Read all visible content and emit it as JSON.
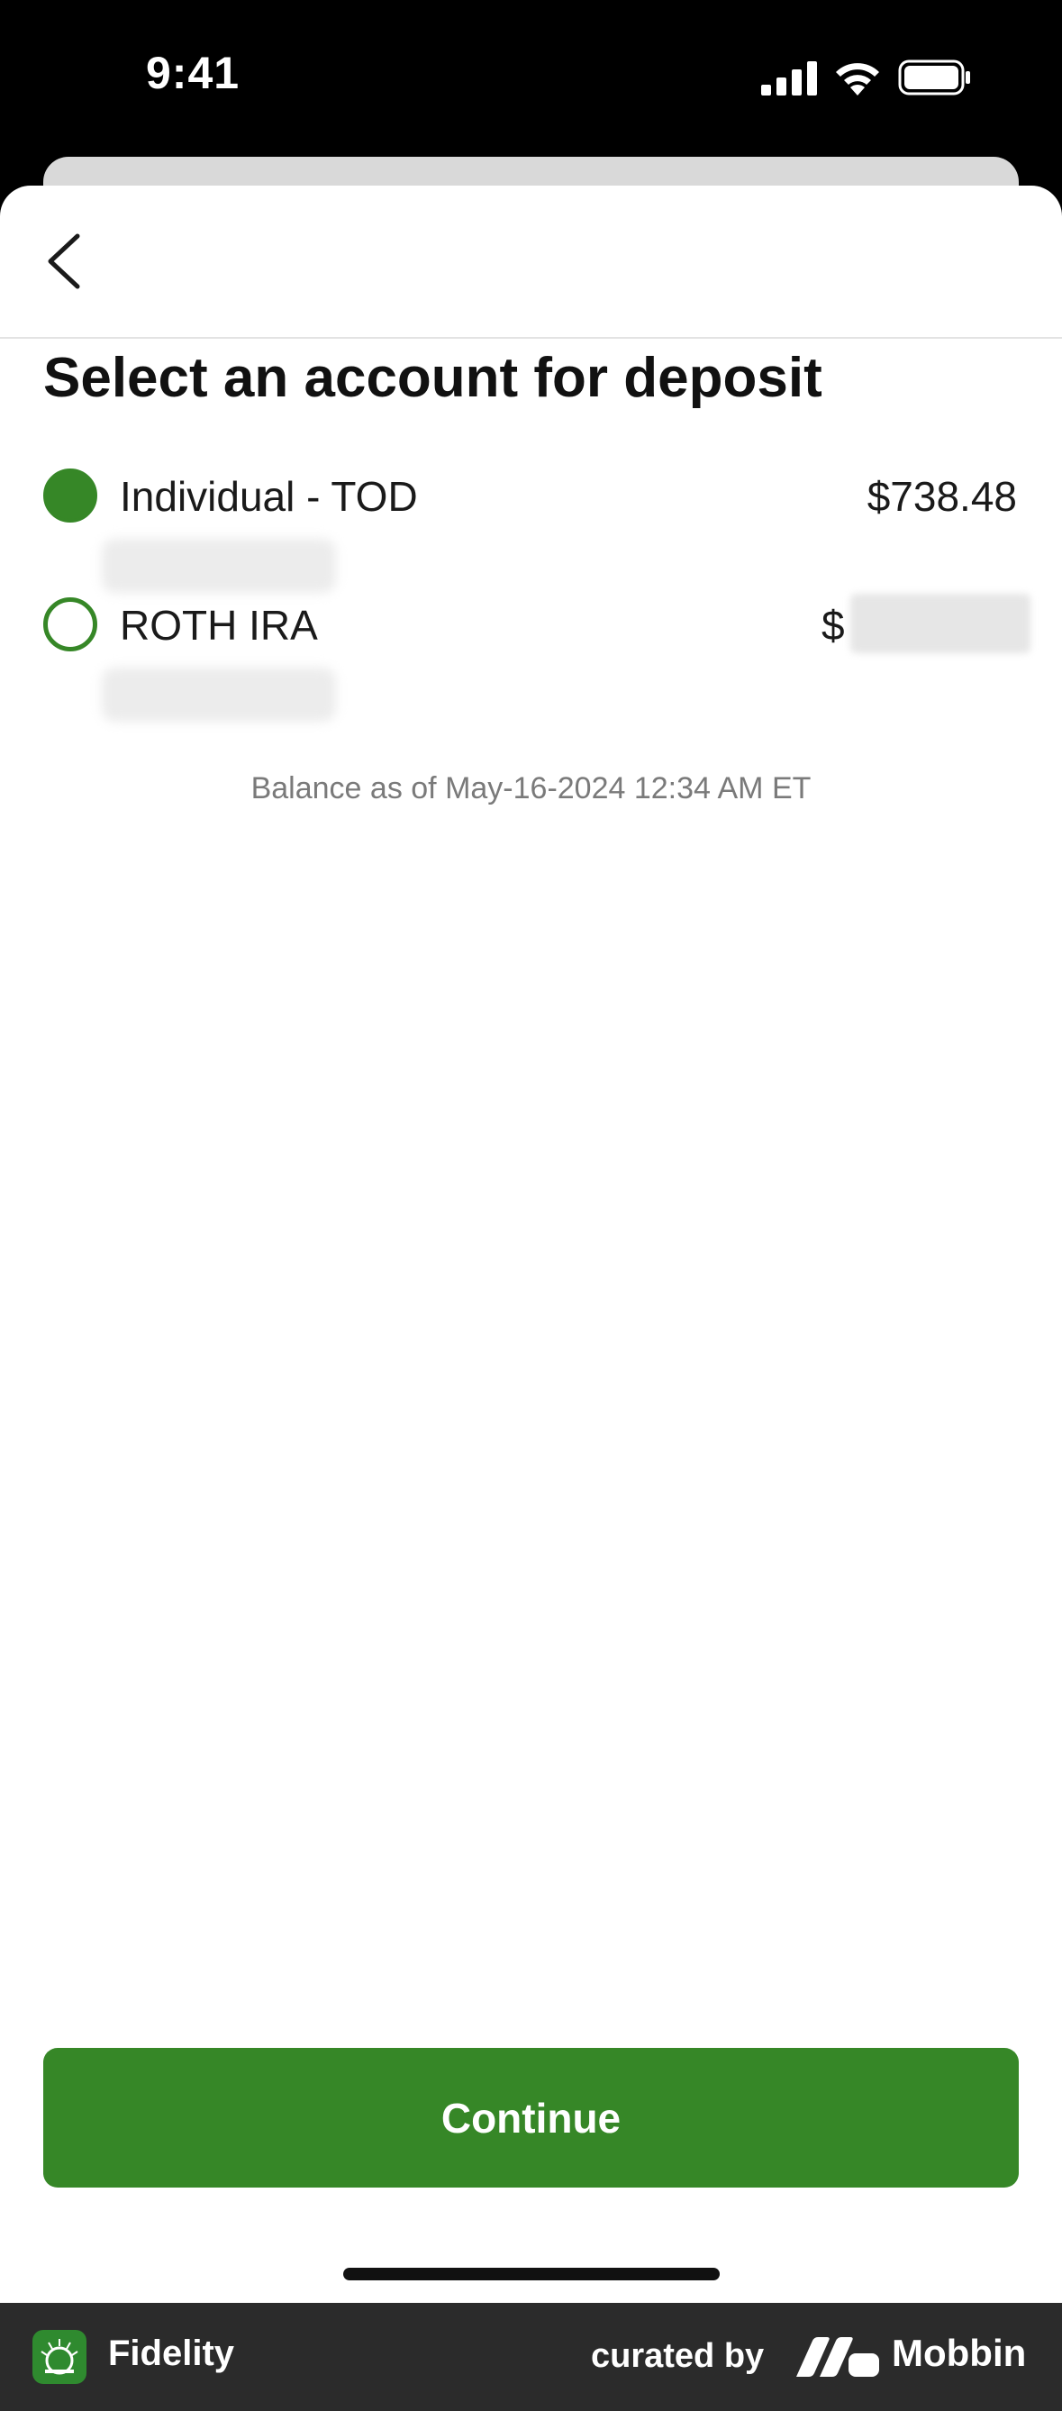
{
  "status_bar": {
    "time": "9:41",
    "icons": [
      "signal-icon",
      "wifi-icon",
      "battery-icon"
    ]
  },
  "nav": {
    "back_icon": "chevron-left-icon"
  },
  "page": {
    "title": "Select an account for deposit"
  },
  "accounts": [
    {
      "name": "Individual - TOD",
      "balance": "$738.48",
      "selected": true,
      "account_number": ""
    },
    {
      "name": "ROTH IRA",
      "balance_currency": "$",
      "balance": "",
      "selected": false,
      "account_number": ""
    }
  ],
  "balance_note": "Balance as of May-16-2024 12:34 AM ET",
  "actions": {
    "continue_label": "Continue"
  },
  "footer": {
    "app_name": "Fidelity",
    "curated_by": "curated by",
    "brand": "Mobbin"
  },
  "colors": {
    "accent": "#368727",
    "footer_bg": "#2b2b2b"
  }
}
